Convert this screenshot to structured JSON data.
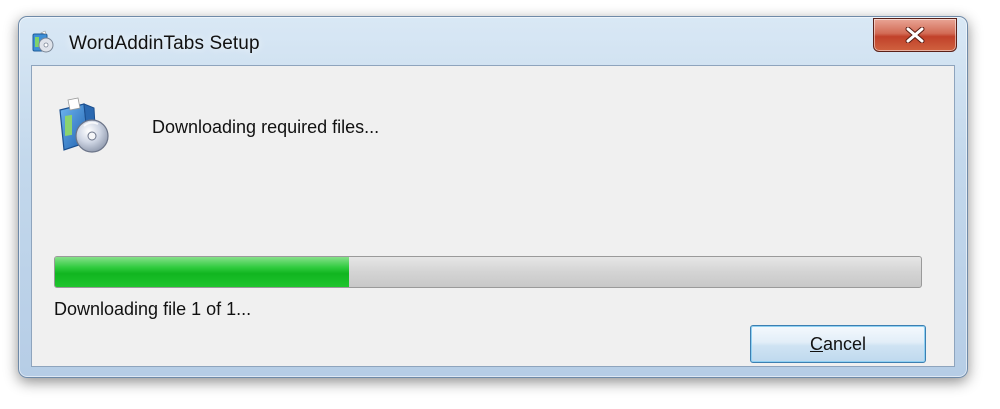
{
  "window": {
    "title": "WordAddinTabs Setup",
    "title_icon": "setup-cd-icon",
    "close_icon": "close-icon"
  },
  "main": {
    "icon": "setup-cd-icon",
    "heading": "Downloading required files...",
    "progress": {
      "fraction": 0.34,
      "fill_color": "#1cbd2a"
    },
    "status": "Downloading file 1 of 1...",
    "cancel": {
      "accelerator": "C",
      "rest": "ancel"
    }
  }
}
